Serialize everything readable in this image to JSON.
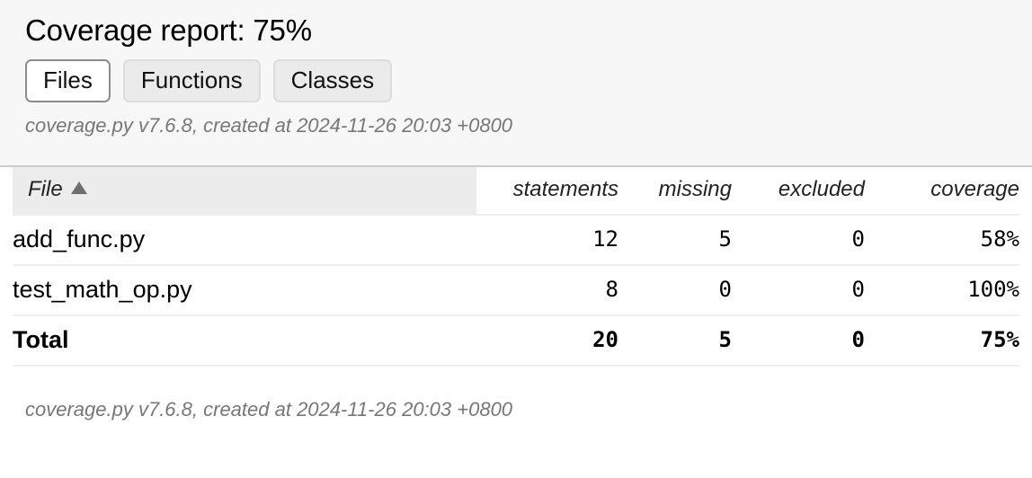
{
  "header": {
    "title": "Coverage report: 75%",
    "tabs": [
      {
        "label": "Files",
        "active": true
      },
      {
        "label": "Functions",
        "active": false
      },
      {
        "label": "Classes",
        "active": false
      }
    ],
    "meta": "coverage.py v7.6.8, created at 2024-11-26 20:03 +0800"
  },
  "table": {
    "columns": [
      {
        "key": "file",
        "label": "File",
        "sorted": true,
        "sort_direction": "ascending",
        "sort_icon": "triangle-up-icon"
      },
      {
        "key": "statements",
        "label": "statements"
      },
      {
        "key": "missing",
        "label": "missing"
      },
      {
        "key": "excluded",
        "label": "excluded"
      },
      {
        "key": "coverage",
        "label": "coverage"
      }
    ],
    "rows": [
      {
        "file": "add_func.py",
        "statements": "12",
        "missing": "5",
        "excluded": "0",
        "coverage": "58%"
      },
      {
        "file": "test_math_op.py",
        "statements": "8",
        "missing": "0",
        "excluded": "0",
        "coverage": "100%"
      }
    ],
    "total": {
      "file": "Total",
      "statements": "20",
      "missing": "5",
      "excluded": "0",
      "coverage": "75%"
    }
  },
  "footer": {
    "meta": "coverage.py v7.6.8, created at 2024-11-26 20:03 +0800"
  },
  "colors": {
    "header_background": "#f7f7f7",
    "header_rule": "#cccccc",
    "sorted_column_background": "#ececec",
    "row_rule": "#eeeeee",
    "meta_text": "#777777",
    "active_tab_border": "#8c8c8c",
    "tab_background": "#ebebeb"
  }
}
